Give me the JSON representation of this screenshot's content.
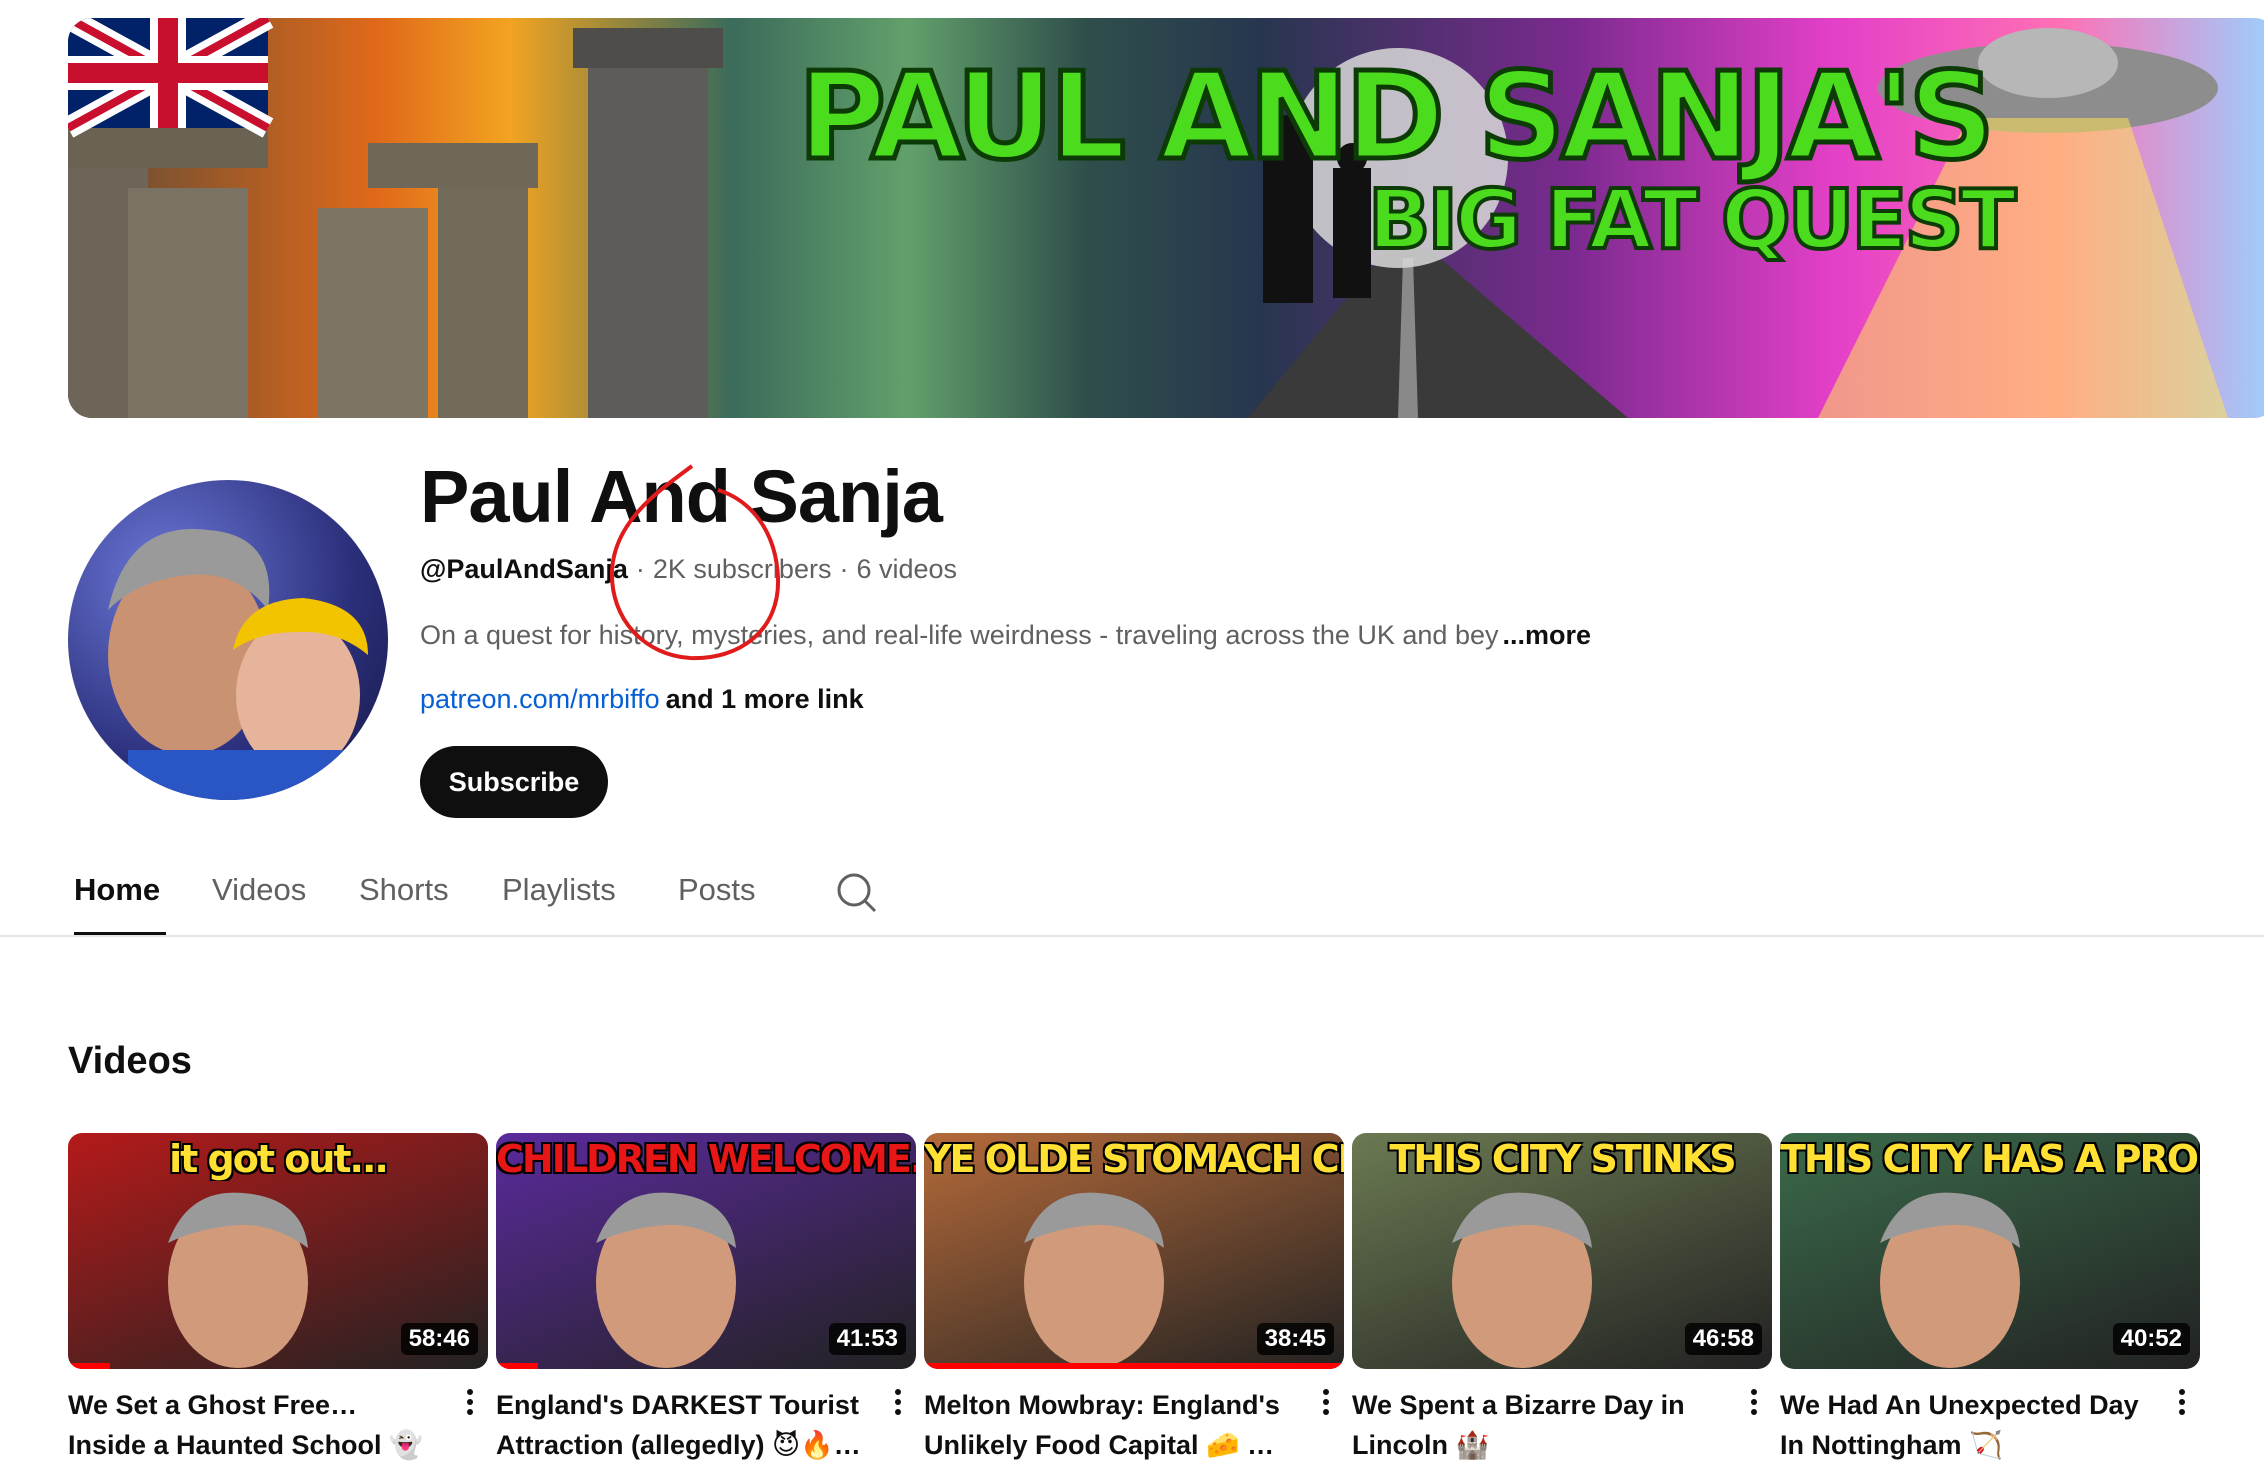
{
  "banner": {
    "title_line1": "PAUL AND SANJA'S",
    "title_line2": "BIG FAT QUEST"
  },
  "channel": {
    "name": "Paul And Sanja",
    "handle": "@PaulAndSanja",
    "subscribers": "2K subscribers",
    "videos_count": "6 videos",
    "description": "On a quest for history, mysteries, and real-life weirdness - traveling across the UK and bey",
    "more_label": "...more",
    "link": "patreon.com/mrbiffo",
    "more_links": "and 1 more link",
    "subscribe_label": "Subscribe"
  },
  "tabs": [
    "Home",
    "Videos",
    "Shorts",
    "Playlists",
    "Posts"
  ],
  "active_tab": "Home",
  "videos_section": {
    "title": "Videos",
    "items": [
      {
        "thumb_text": "it got out...",
        "thumb_text_color": "#ffe033",
        "thumb_bg": "#b51a1a",
        "duration": "58:46",
        "progress": 0.1,
        "title": "We Set a Ghost Free… Inside a Haunted School 👻"
      },
      {
        "thumb_text": "CHILDREN WELCOME...",
        "thumb_text_color": "#e81616",
        "thumb_bg": "#5a2a9c",
        "duration": "41:53",
        "progress": 0.1,
        "title": "England's DARKEST Tourist Attraction (allegedly) 😈🔥…"
      },
      {
        "thumb_text": "YE OLDE STOMACH CRAMPS",
        "thumb_text_color": "#ffe033",
        "thumb_bg": "#b56a3a",
        "duration": "38:45",
        "progress": 1.0,
        "title": "Melton Mowbray: England's Unlikely Food Capital 🧀 …"
      },
      {
        "thumb_text": "THIS CITY STINKS",
        "thumb_text_color": "#ffe033",
        "thumb_bg": "#6b7a52",
        "duration": "46:58",
        "progress": 0.0,
        "title": "We Spent a Bizarre Day in Lincoln 🏰"
      },
      {
        "thumb_text": "THIS CITY HAS A PROBLEM",
        "thumb_text_color": "#ffe033",
        "thumb_bg": "#3a6a4a",
        "duration": "40:52",
        "progress": 0.0,
        "title": "We Had An Unexpected Day In Nottingham 🏹"
      }
    ]
  },
  "colors": {
    "link": "#065fd4",
    "accent": "#ff0000",
    "text_primary": "#0f0f0f",
    "text_secondary": "#606060",
    "annotation": "#e01b1b",
    "banner_title": "#4cdc1e"
  },
  "icons": [
    "search-icon",
    "kebab-menu-icon",
    "union-jack-flag",
    "ufo-icon"
  ]
}
